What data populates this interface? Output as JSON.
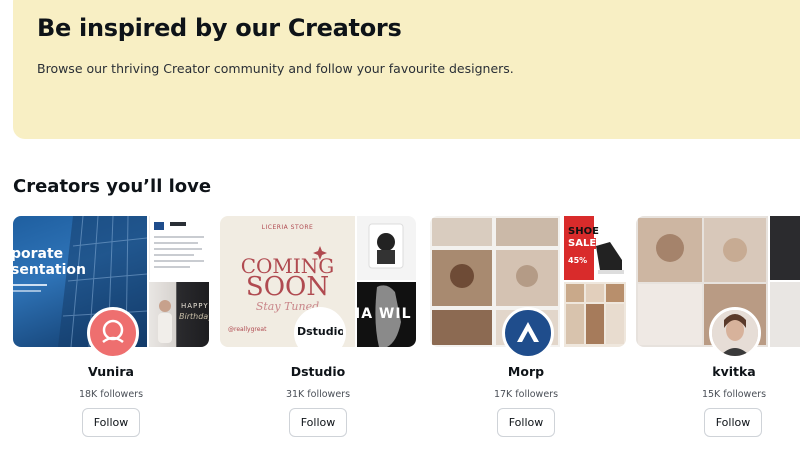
{
  "hero": {
    "title": "Be inspired by our Creators",
    "subtitle": "Browse our thriving Creator community and follow your favourite designers."
  },
  "section": {
    "title": "Creators you’ll love"
  },
  "creators": [
    {
      "name": "Vunira",
      "followers": "18K followers",
      "follow_label": "Follow",
      "tile_text": [
        "porate",
        "sentation",
        "HAPPY",
        "Birthday"
      ]
    },
    {
      "name": "Dstudio",
      "followers": "31K followers",
      "follow_label": "Follow",
      "tile_text": [
        "LICERIA STORE",
        "COMING",
        "SOON",
        "Stay Tuned",
        "@reallygreat",
        "Dstudio",
        "IA WIL"
      ]
    },
    {
      "name": "Morp",
      "followers": "17K followers",
      "follow_label": "Follow",
      "tile_text": [
        "SHOE",
        "SALE",
        "45%"
      ]
    },
    {
      "name": "kvitka",
      "followers": "15K followers",
      "follow_label": "Follow",
      "tile_text": []
    }
  ],
  "colors": {
    "hero_bg": "#f8efc4",
    "vunira_avatar": "#ee6f6f",
    "morp_avatar": "#1f4d8c",
    "coming_soon": "#b04a50"
  }
}
